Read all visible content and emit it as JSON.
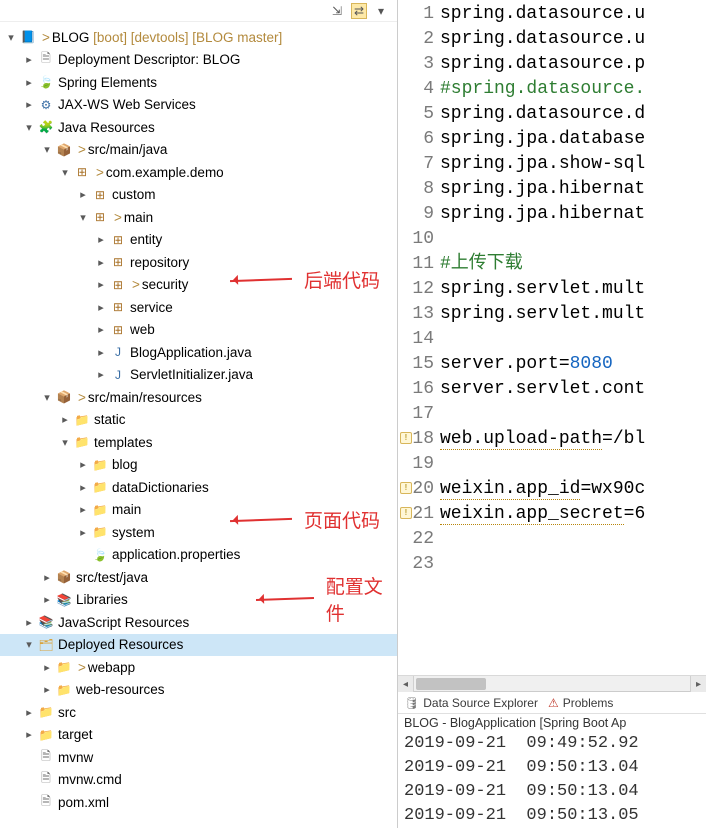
{
  "toolbar_icons": [
    "collapse-all",
    "link-editor",
    "view-menu"
  ],
  "tree": {
    "root": {
      "label": "BLOG",
      "decor": "[boot] [devtools] [BLOG master]",
      "gt": true
    },
    "deploy_desc": "Deployment Descriptor: BLOG",
    "spring_elements": "Spring Elements",
    "jaxws": "JAX-WS Web Services",
    "java_resources": "Java Resources",
    "src_main_java": {
      "label": "src/main/java",
      "gt": true
    },
    "pkg_root": {
      "label": "com.example.demo",
      "gt": true
    },
    "pkg_custom": "custom",
    "pkg_main": {
      "label": "main",
      "gt": true
    },
    "pkg_entity": "entity",
    "pkg_repository": "repository",
    "pkg_security": {
      "label": "security",
      "gt": true
    },
    "pkg_service": "service",
    "pkg_web": "web",
    "blog_app": "BlogApplication.java",
    "servlet_init": "ServletInitializer.java",
    "src_main_resources": {
      "label": "src/main/resources",
      "gt": true
    },
    "static": "static",
    "templates": "templates",
    "tpl_blog": "blog",
    "tpl_dd": "dataDictionaries",
    "tpl_main": "main",
    "tpl_system": "system",
    "app_props": "application.properties",
    "src_test_java": "src/test/java",
    "libraries": "Libraries",
    "js_resources": "JavaScript Resources",
    "deployed_resources": "Deployed Resources",
    "webapp": {
      "label": "webapp",
      "gt": true
    },
    "web_resources": "web-resources",
    "src": "src",
    "target": "target",
    "mvnw": "mvnw",
    "mvnw_cmd": "mvnw.cmd",
    "pom_xml": "pom.xml"
  },
  "annotations": {
    "backend": "后端代码",
    "page": "页面代码",
    "config": "配置文件"
  },
  "editor": {
    "lines": [
      {
        "n": 1,
        "text": "spring.datasource.u"
      },
      {
        "n": 2,
        "text": "spring.datasource.u"
      },
      {
        "n": 3,
        "text": "spring.datasource.p"
      },
      {
        "n": 4,
        "text": "#spring.datasource.",
        "comment": true
      },
      {
        "n": 5,
        "text": "spring.datasource.d"
      },
      {
        "n": 6,
        "text": "spring.jpa.database"
      },
      {
        "n": 7,
        "text": "spring.jpa.show-sql"
      },
      {
        "n": 8,
        "text": "spring.jpa.hibernat"
      },
      {
        "n": 9,
        "text": "spring.jpa.hibernat"
      },
      {
        "n": 10,
        "text": ""
      },
      {
        "n": 11,
        "text": "#上传下载",
        "comment": true
      },
      {
        "n": 12,
        "text": "spring.servlet.mult"
      },
      {
        "n": 13,
        "text": "spring.servlet.mult"
      },
      {
        "n": 14,
        "text": ""
      },
      {
        "n": 15,
        "key": "server.port=",
        "val": "8080"
      },
      {
        "n": 16,
        "text": "server.servlet.cont"
      },
      {
        "n": 17,
        "text": ""
      },
      {
        "n": 18,
        "warn": true,
        "wkey": "web.upload-path",
        "rest": "=/bl"
      },
      {
        "n": 19,
        "text": ""
      },
      {
        "n": 20,
        "warn": true,
        "wkey": "weixin.app_id",
        "rest": "=wx90c"
      },
      {
        "n": 21,
        "warn": true,
        "wkey": "weixin.app_secret",
        "rest": "=6"
      },
      {
        "n": 22,
        "text": ""
      },
      {
        "n": 23,
        "text": ""
      }
    ]
  },
  "bottom": {
    "tab_dse": "Data Source Explorer",
    "tab_problems": "Problems",
    "console_title": "BLOG - BlogApplication [Spring Boot Ap",
    "lines": [
      "2019-09-21  09:49:52.92",
      "2019-09-21  09:50:13.04",
      "2019-09-21  09:50:13.04",
      "2019-09-21  09:50:13.05"
    ]
  },
  "watermark": ""
}
